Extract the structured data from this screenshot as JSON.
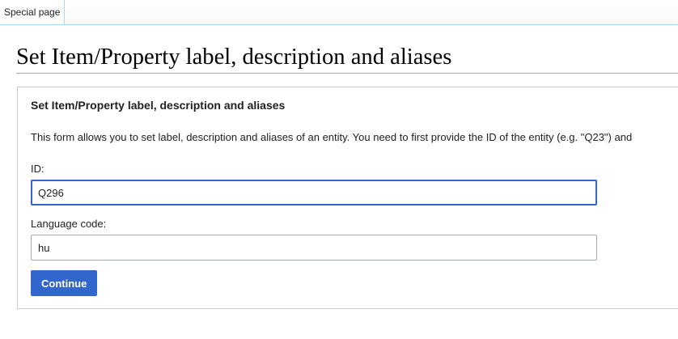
{
  "tabs": [
    {
      "label": "Special page"
    }
  ],
  "page": {
    "title": "Set Item/Property label, description and aliases"
  },
  "form": {
    "legend": "Set Item/Property label, description and aliases",
    "intro": "This form allows you to set label, description and aliases of an entity. You need to first provide the ID of the entity (e.g. \"Q23\") and",
    "id_label": "ID:",
    "id_value": "Q296",
    "language_label": "Language code:",
    "language_value": "hu",
    "submit_label": "Continue"
  },
  "colors": {
    "accent": "#3366cc",
    "tab_border": "#a7d7f9",
    "title_rule": "#a2a9b1"
  }
}
